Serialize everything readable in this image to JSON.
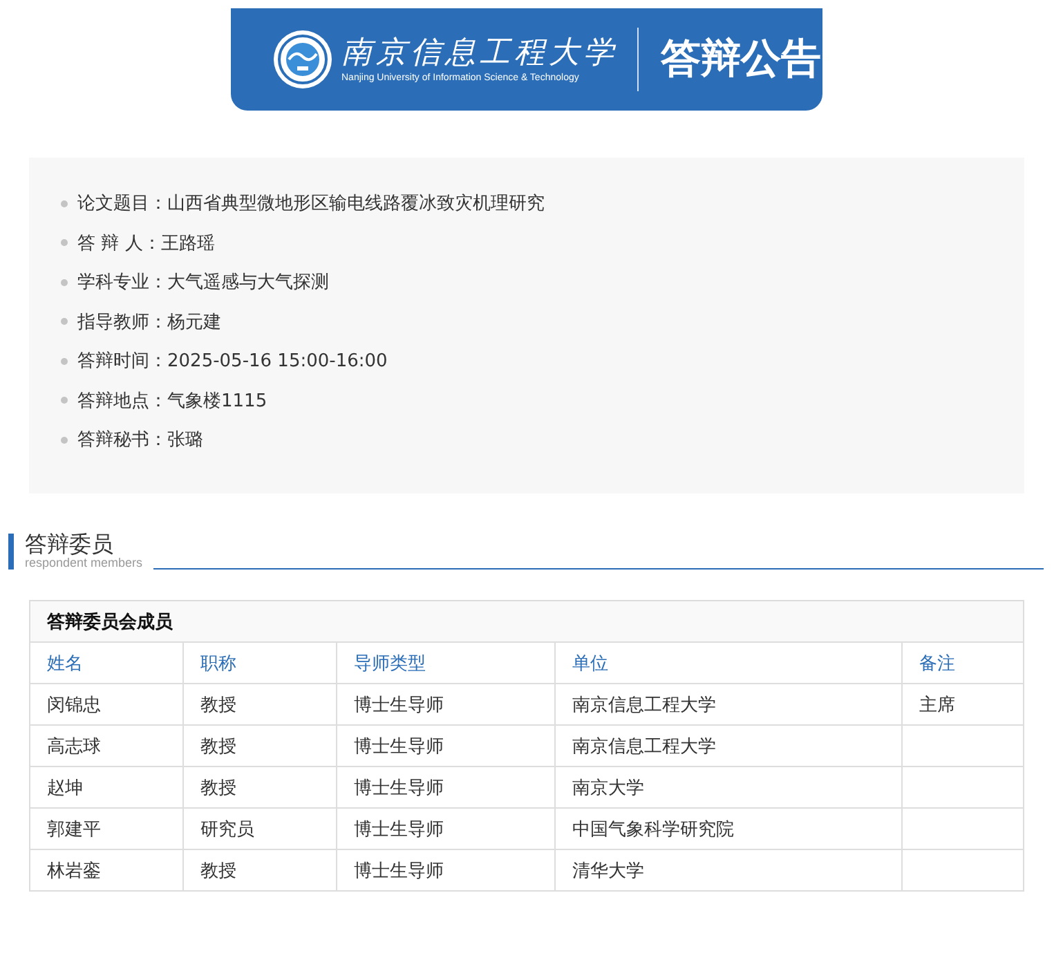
{
  "banner": {
    "university_name": "南京信息工程大学",
    "university_name_en": "Nanjing University of Information Science & Technology",
    "title": "答辩公告"
  },
  "info": [
    {
      "label": "论文题目：",
      "value": "山西省典型微地形区输电线路覆冰致灾机理研究"
    },
    {
      "label": "答 辩 人：",
      "value": "王路瑶"
    },
    {
      "label": "学科专业：",
      "value": "大气遥感与大气探测"
    },
    {
      "label": "指导教师：",
      "value": "杨元建"
    },
    {
      "label": "答辩时间：",
      "value": "2025-05-16 15:00-16:00"
    },
    {
      "label": "答辩地点：",
      "value": "气象楼1115"
    },
    {
      "label": "答辩秘书：",
      "value": "张璐"
    }
  ],
  "section": {
    "title": "答辩委员",
    "subtitle": "respondent members"
  },
  "table": {
    "caption": "答辩委员会成员",
    "columns": [
      "姓名",
      "职称",
      "导师类型",
      "单位",
      "备注"
    ],
    "rows": [
      [
        "闵锦忠",
        "教授",
        "博士生导师",
        "南京信息工程大学",
        "主席"
      ],
      [
        "高志球",
        "教授",
        "博士生导师",
        "南京信息工程大学",
        ""
      ],
      [
        "赵坤",
        "教授",
        "博士生导师",
        "南京大学",
        ""
      ],
      [
        "郭建平",
        "研究员",
        "博士生导师",
        "中国气象科学研究院",
        ""
      ],
      [
        "林岩銮",
        "教授",
        "博士生导师",
        "清华大学",
        ""
      ]
    ]
  }
}
